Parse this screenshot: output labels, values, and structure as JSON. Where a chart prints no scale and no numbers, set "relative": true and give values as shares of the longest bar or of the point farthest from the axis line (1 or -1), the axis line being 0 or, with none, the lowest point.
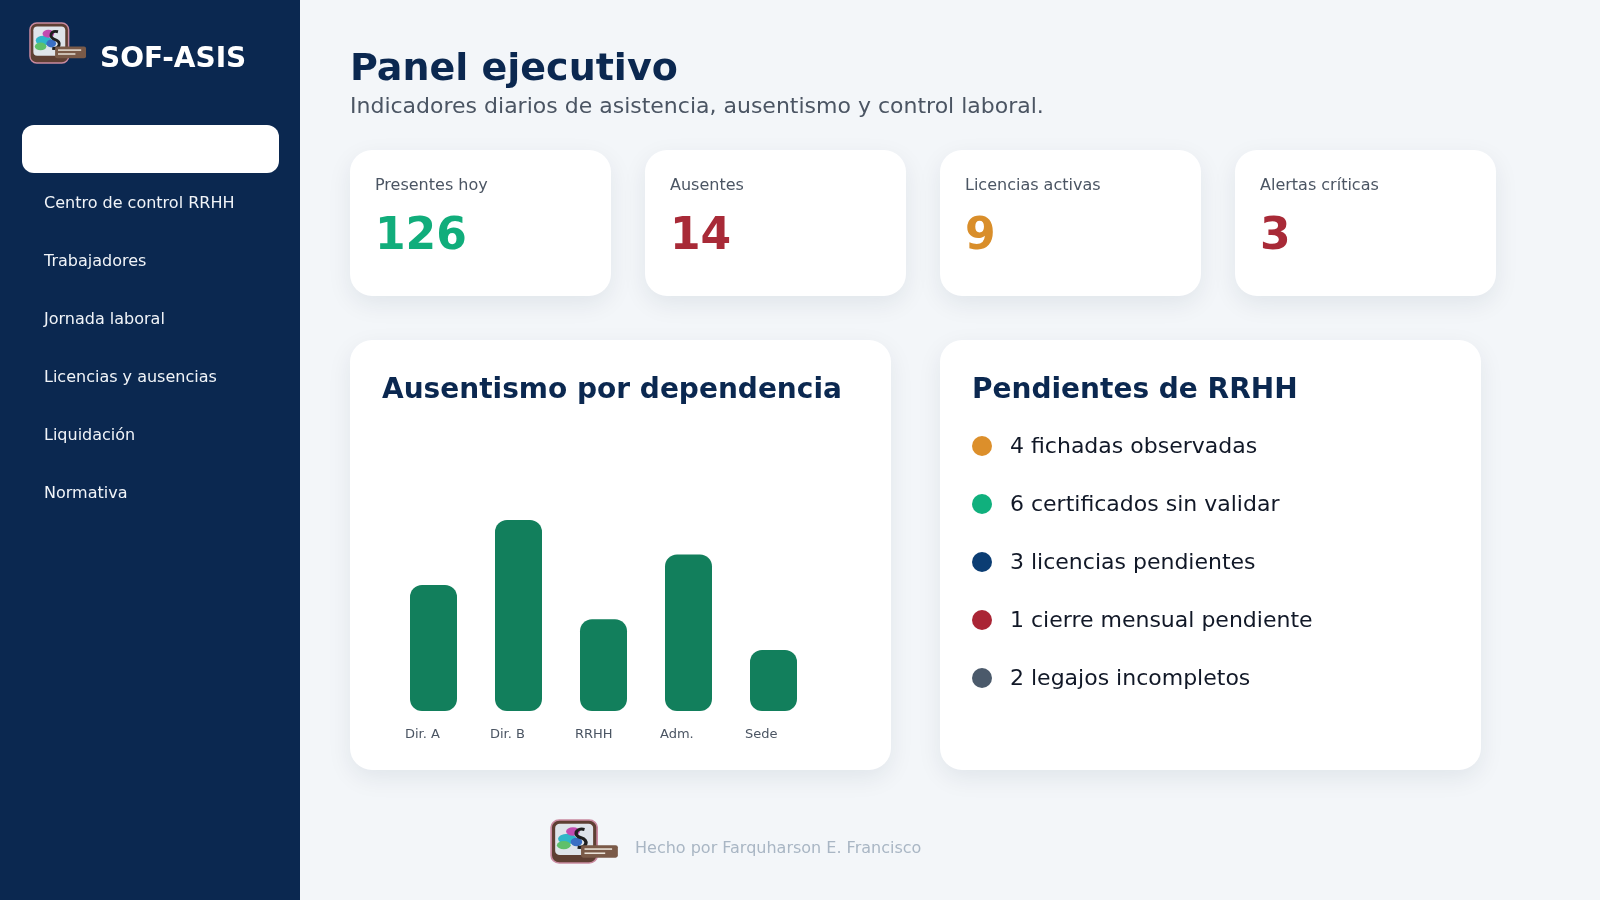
{
  "sidebar": {
    "brand": "SOF-ASIS",
    "items": [
      {
        "selected": true
      },
      {
        "label": "Centro de control RRHH",
        "selected": false
      },
      {
        "label": "Trabajadores",
        "selected": false
      },
      {
        "label": "Jornada laboral",
        "selected": false
      },
      {
        "label": "Licencias y ausencias",
        "selected": false
      },
      {
        "label": "Liquidación",
        "selected": false
      },
      {
        "label": "Normativa",
        "selected": false
      }
    ]
  },
  "header": {
    "title": "Panel ejecutivo",
    "subtitle": "Indicadores diarios de asistencia, ausentismo y control laboral."
  },
  "kpi_cards": [
    {
      "label": "Presentes hoy",
      "value": "126",
      "color": "#11ad7b"
    },
    {
      "label": "Ausentes",
      "value": "14",
      "color": "#a82a37"
    },
    {
      "label": "Licencias activas",
      "value": "9",
      "color": "#d98e2a"
    },
    {
      "label": "Alertas críticas",
      "value": "3",
      "color": "#a82a37"
    }
  ],
  "absence_panel": {
    "title": "Ausentismo por dependencia",
    "chart_data": {
      "type": "bar",
      "relative": true,
      "categories": [
        "Dir. A",
        "Dir. B",
        "RRHH",
        "Adm.",
        "Sede"
      ],
      "values": [
        0.66,
        1,
        0.48,
        0.82,
        0.32
      ]
    }
  },
  "pending_panel": {
    "title": "Pendientes de RRHH",
    "items": [
      {
        "text": "4 fichadas observadas",
        "color": "#dc8f2b"
      },
      {
        "text": "6 certificados sin validar",
        "color": "#10b07d"
      },
      {
        "text": "3 licencias pendientes",
        "color": "#0b3d73"
      },
      {
        "text": "1 cierre mensual pendiente",
        "color": "#aa2535"
      },
      {
        "text": "2 legajos incompletos",
        "color": "#4b5a6b"
      }
    ]
  },
  "footer": {
    "text": "Hecho por Farquharson E. Francisco"
  }
}
